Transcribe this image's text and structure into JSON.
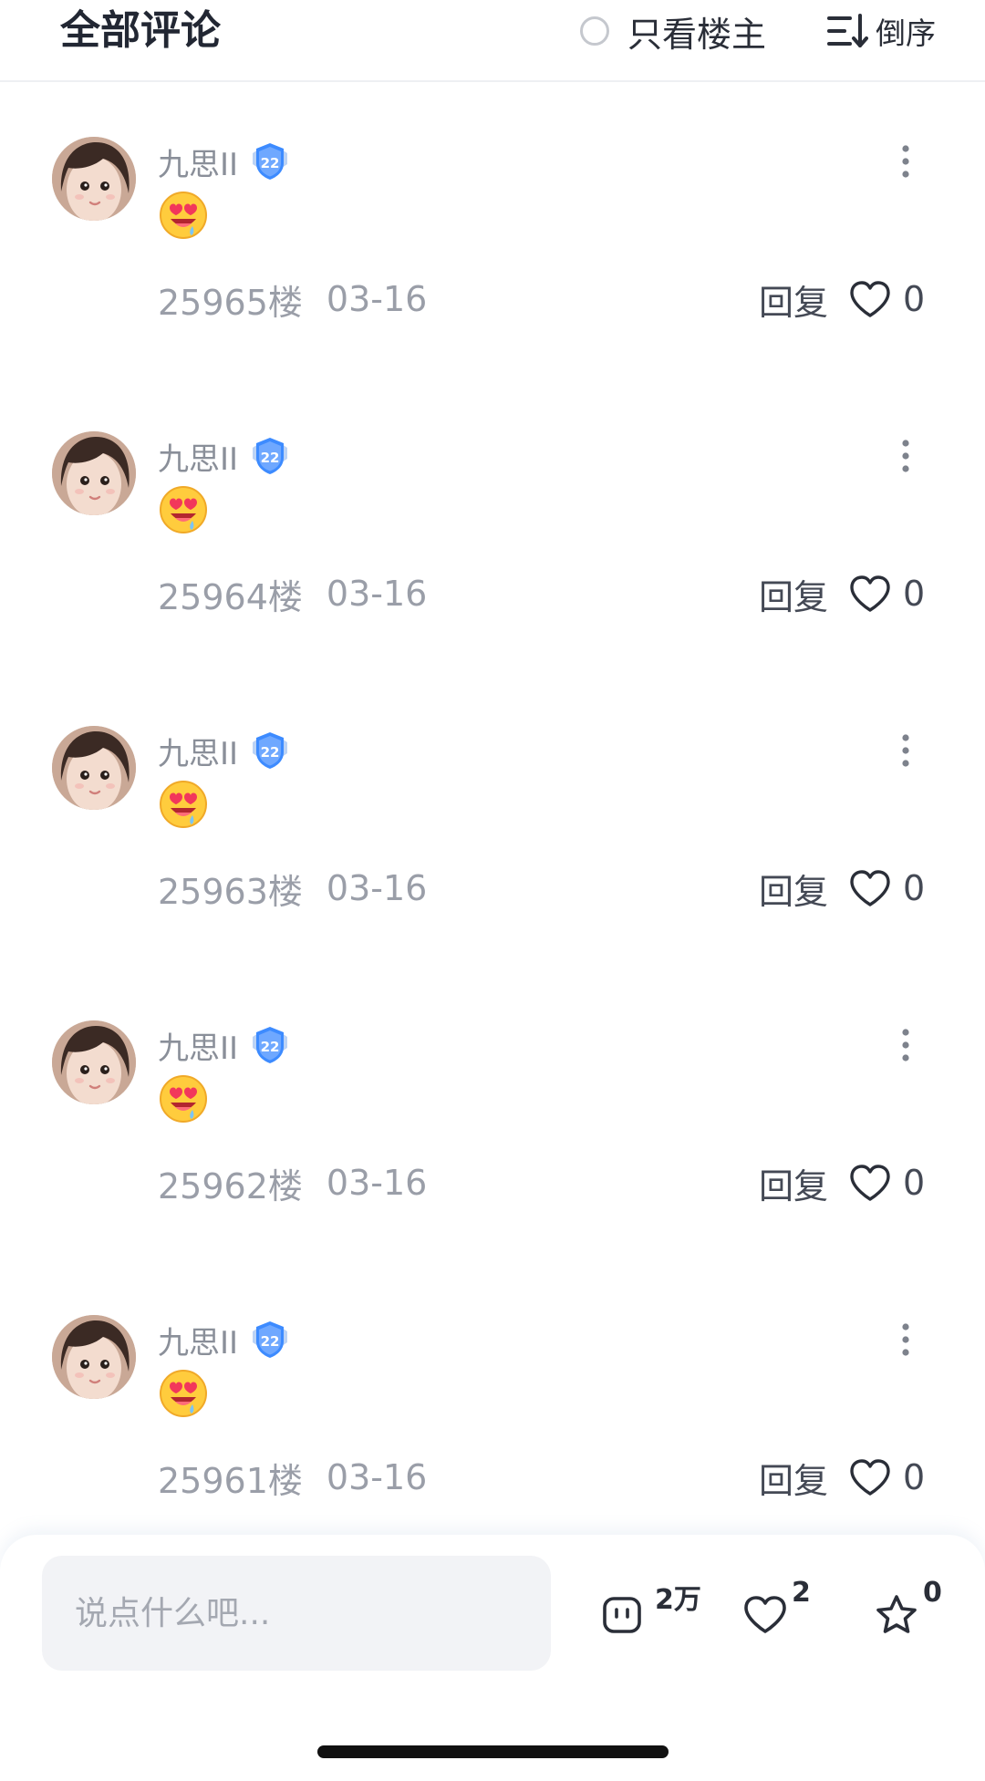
{
  "header": {
    "title": "全部评论",
    "op_only_label": "只看楼主",
    "sort_label": "倒序"
  },
  "comments": [
    {
      "username": "九思II",
      "level": "22",
      "emoji": "heart-eyes-drool-emoji",
      "floor": "25965楼",
      "date": "03-16",
      "reply_label": "回复",
      "likes": "0"
    },
    {
      "username": "九思II",
      "level": "22",
      "emoji": "heart-eyes-drool-emoji",
      "floor": "25964楼",
      "date": "03-16",
      "reply_label": "回复",
      "likes": "0"
    },
    {
      "username": "九思II",
      "level": "22",
      "emoji": "heart-eyes-drool-emoji",
      "floor": "25963楼",
      "date": "03-16",
      "reply_label": "回复",
      "likes": "0"
    },
    {
      "username": "九思II",
      "level": "22",
      "emoji": "heart-eyes-drool-emoji",
      "floor": "25962楼",
      "date": "03-16",
      "reply_label": "回复",
      "likes": "0"
    },
    {
      "username": "九思II",
      "level": "22",
      "emoji": "heart-eyes-drool-emoji",
      "floor": "25961楼",
      "date": "03-16",
      "reply_label": "回复",
      "likes": "0"
    }
  ],
  "bottom_bar": {
    "input_placeholder": "说点什么吧...",
    "comment_count": "2万",
    "like_count": "2",
    "favorite_count": "0"
  },
  "colors": {
    "accent_badge": "#3d8bff",
    "text_secondary": "#9a9ea8",
    "input_bg": "#f2f3f6"
  }
}
